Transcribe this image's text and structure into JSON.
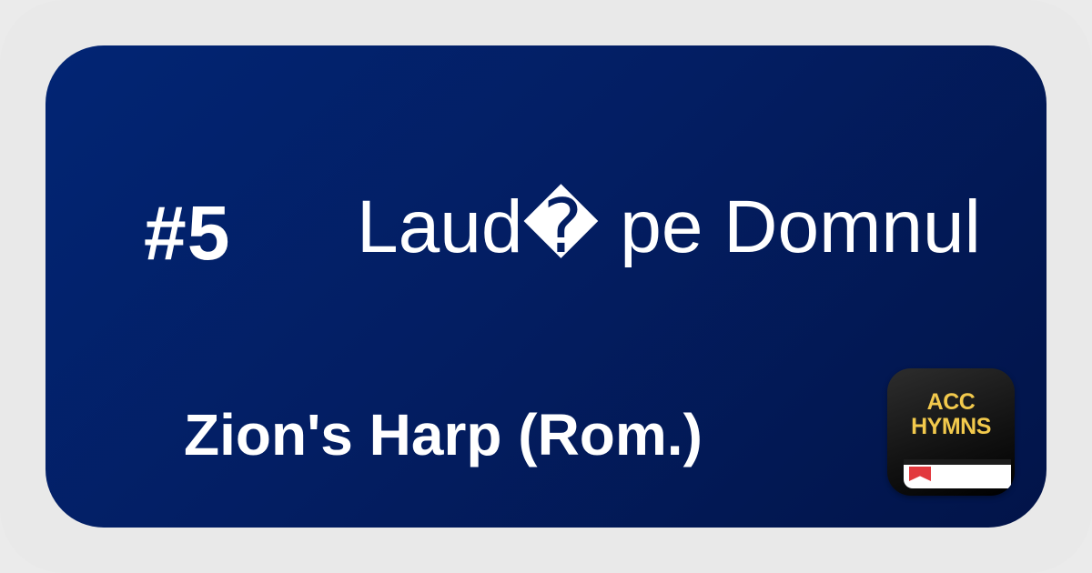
{
  "hymn": {
    "number": "#5",
    "title": "Laud� pe Domnul",
    "hymnal": "Zion's Harp (Rom.)"
  },
  "app_icon": {
    "line1": "ACC",
    "line2": "HYMNS",
    "text_color": "#f2c94c",
    "bookmark_color": "#e2393e"
  },
  "colors": {
    "background": "#e9e9e9",
    "card_gradient_start": "#022574",
    "card_gradient_end": "#021449",
    "text": "#ffffff"
  }
}
